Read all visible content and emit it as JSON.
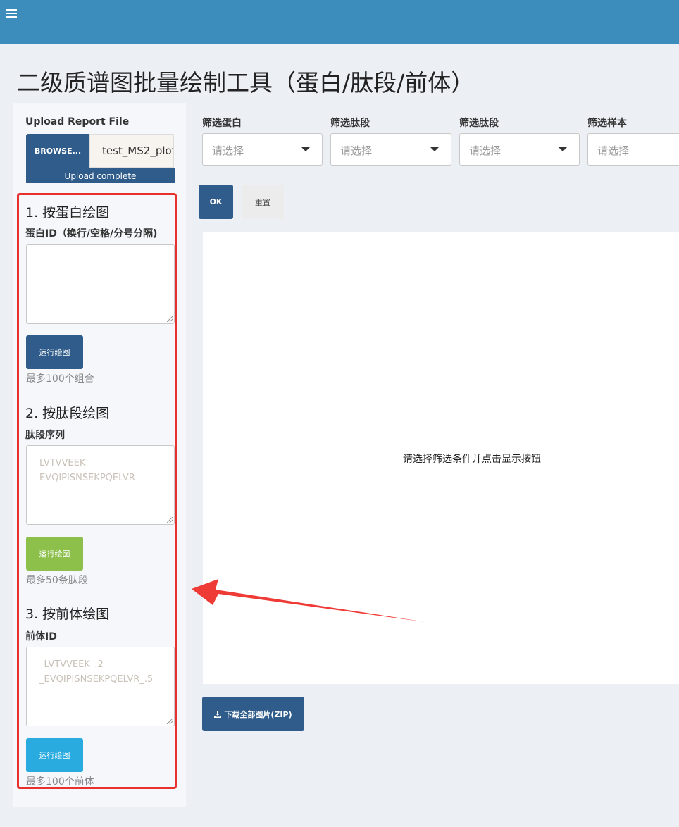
{
  "header": {
    "menu_icon": "hamburger-icon"
  },
  "page": {
    "title": "二级质谱图批量绘制工具（蛋白/肽段/前体）"
  },
  "sidebar": {
    "upload_label": "Upload Report File",
    "browse_label": "BROWSE...",
    "file_name": "test_MS2_plot",
    "upload_status": "Upload complete",
    "sections": [
      {
        "title": "1. 按蛋白绘图",
        "field_label": "蛋白ID（换行/空格/分号分隔)",
        "placeholder_lines": [
          "",
          ""
        ],
        "button_label": "运行绘图",
        "button_color": "#2f5c8a",
        "hint": "最多100个组合"
      },
      {
        "title": "2. 按肽段绘图",
        "field_label": "肽段序列",
        "placeholder_lines": [
          "LVTVVEEK",
          "EVQIPISNSEKPQELVR"
        ],
        "button_label": "运行绘图",
        "button_color": "#8cc04b",
        "hint": "最多50条肽段"
      },
      {
        "title": "3. 按前体绘图",
        "field_label": "前体ID",
        "placeholder_lines": [
          "_LVTVVEEK_.2",
          "_EVQIPISNSEKPQELVR_.5"
        ],
        "button_label": "运行绘图",
        "button_color": "#29abe0",
        "hint": "最多100个前体"
      }
    ]
  },
  "filters": [
    {
      "label": "筛选蛋白",
      "placeholder": "请选择"
    },
    {
      "label": "筛选肽段",
      "placeholder": "请选择"
    },
    {
      "label": "筛选肽段",
      "placeholder": "请选择"
    },
    {
      "label": "筛选样本",
      "placeholder": "请选择"
    }
  ],
  "actions": {
    "ok_label": "OK",
    "reset_label": "重置"
  },
  "plot": {
    "empty_message": "请选择筛选条件并点击显示按钮"
  },
  "download": {
    "label": "下载全部图片(ZIP)",
    "icon": "download-icon"
  },
  "colors": {
    "header": "#3c8dbc",
    "primary": "#2f5c8a",
    "highlight_box": "#e8312f",
    "annotation_arrow": "#ee3b36"
  }
}
